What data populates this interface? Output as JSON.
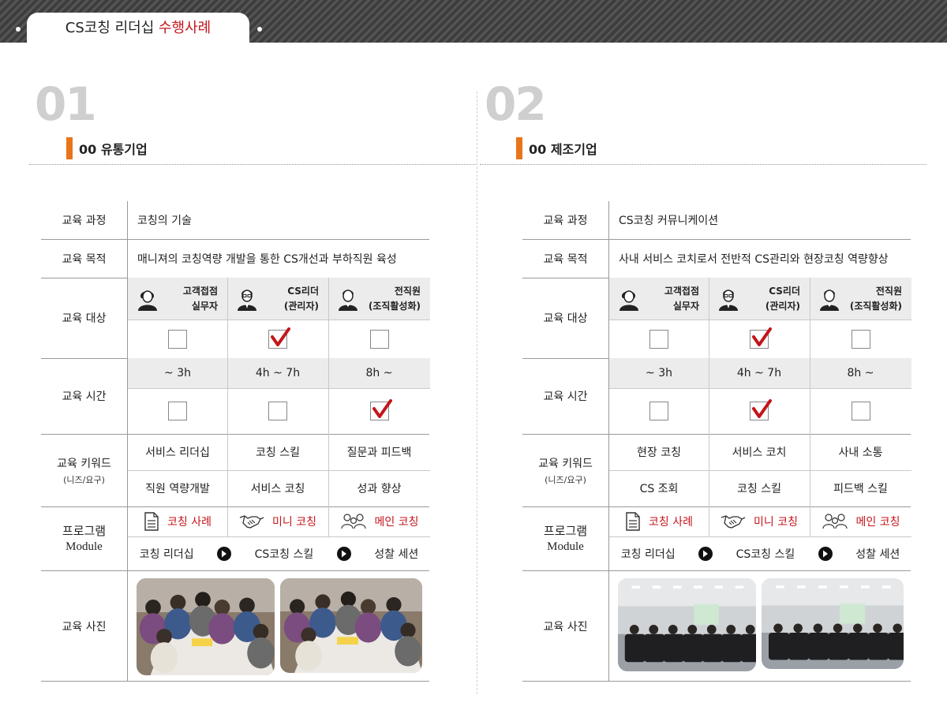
{
  "header": {
    "title_main": "CS코칭 리더십",
    "title_highlight": "수행사례"
  },
  "labels": {
    "course": "교육 과정",
    "purpose": "교육 목적",
    "target": "교육 대상",
    "time": "교육 시간",
    "keyword": "교육 키워드",
    "keyword_sub": "(니즈/요구)",
    "program_1": "프로그램",
    "program_2": "Module",
    "photo": "교육 사진"
  },
  "targets": [
    {
      "line1": "고객접점",
      "line2": "실무자"
    },
    {
      "line1": "CS리더",
      "line2": "(관리자)"
    },
    {
      "line1": "전직원",
      "line2": "(조직활성화)"
    }
  ],
  "times": [
    "~ 3h",
    "4h ~ 7h",
    "8h ~"
  ],
  "modules": [
    "코칭 사례",
    "미니 코칭",
    "메인 코칭"
  ],
  "flow": [
    "코칭 리더십",
    "CS코칭 스킬",
    "성찰 세션"
  ],
  "colors": {
    "accent_red": "#c4151c",
    "accent_orange": "#e8751a"
  },
  "cases": [
    {
      "number": "01",
      "company": "00 유통기업",
      "course": "코칭의 기술",
      "purpose": "매니져의 코칭역량 개발을 통한 CS개선과 부하직원 육성",
      "target_checked": [
        false,
        true,
        false
      ],
      "time_checked": [
        false,
        false,
        true
      ],
      "keywords_row1": [
        "서비스 리더십",
        "코칭 스킬",
        "질문과 피드백"
      ],
      "keywords_row2": [
        "직원 역량개발",
        "서비스 코칭",
        "성과 향상"
      ]
    },
    {
      "number": "02",
      "company": "00 제조기업",
      "course": "CS코칭 커뮤니케이션",
      "purpose": "사내 서비스 코치로서 전반적 CS관리와 현장코칭 역량향상",
      "target_checked": [
        false,
        true,
        false
      ],
      "time_checked": [
        false,
        true,
        false
      ],
      "keywords_row1": [
        "현장 코칭",
        "서비스 코치",
        "사내 소통"
      ],
      "keywords_row2": [
        "CS 조회",
        "코칭 스킬",
        "피드백 스킬"
      ]
    }
  ]
}
